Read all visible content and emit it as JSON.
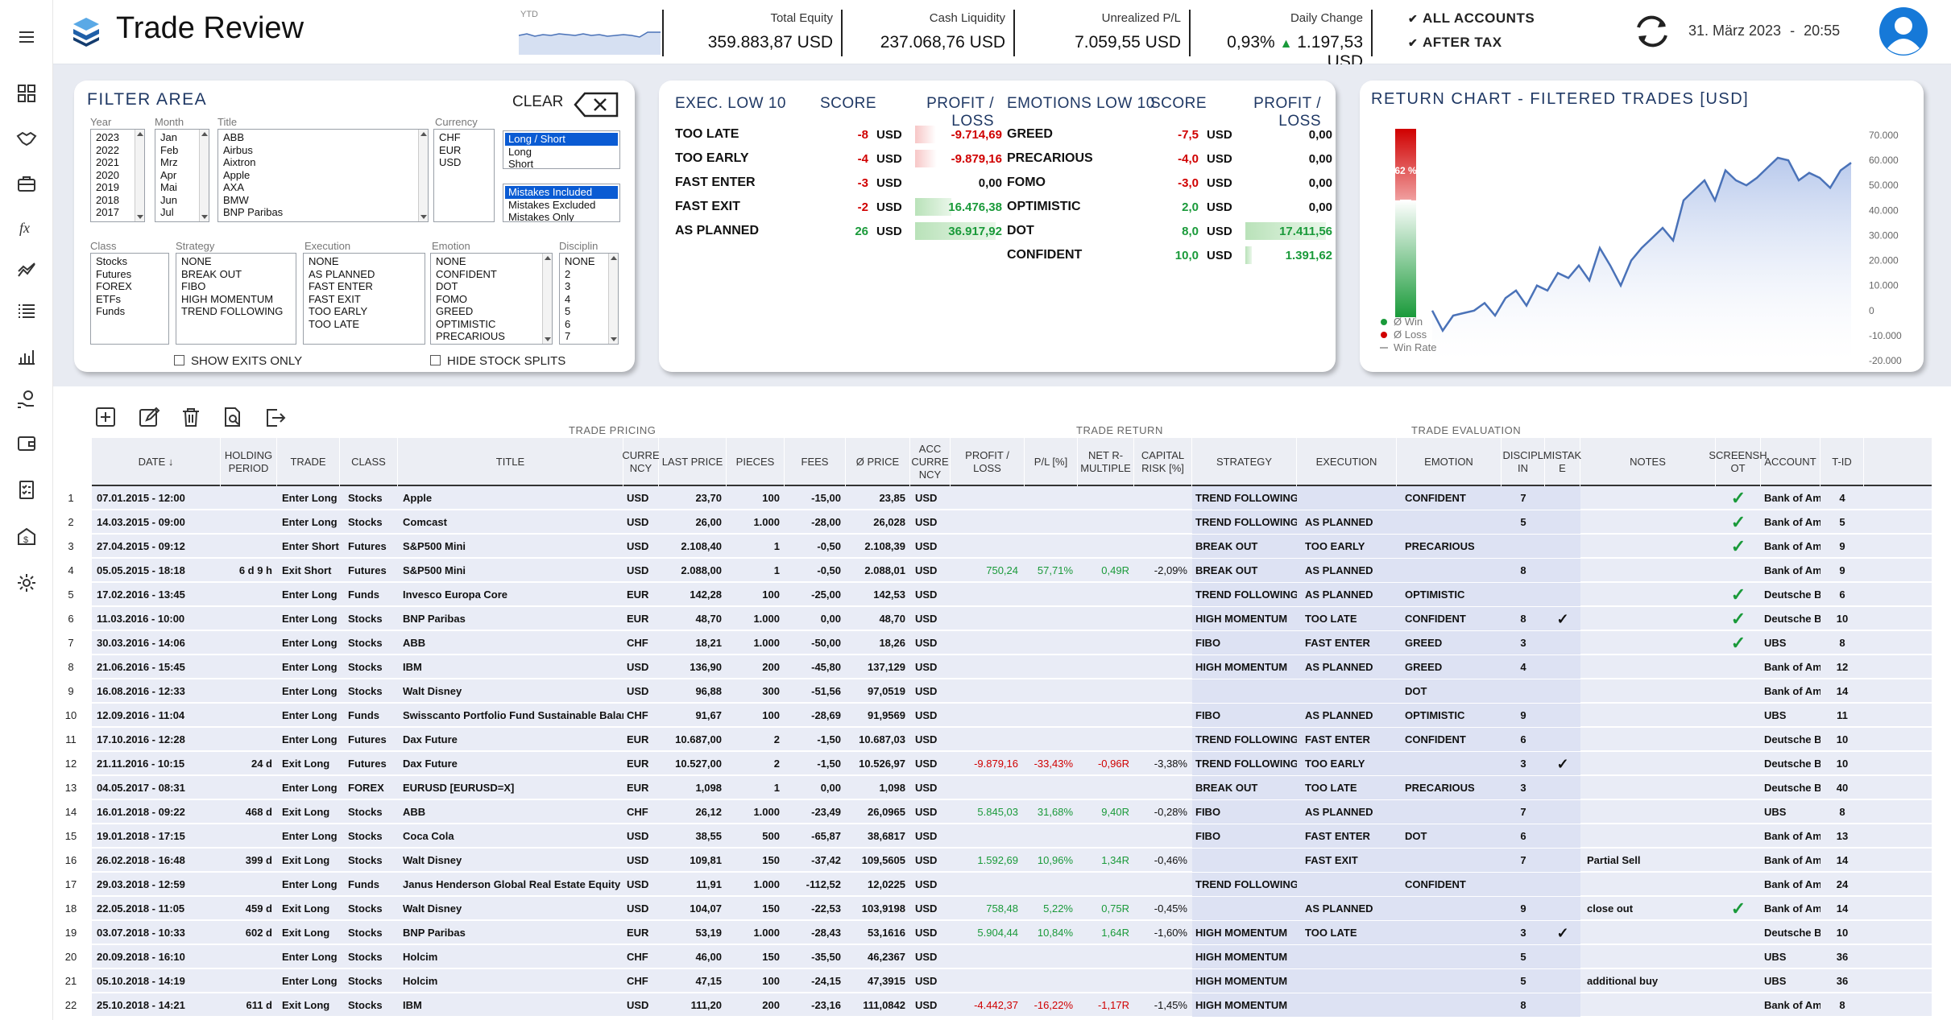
{
  "app": {
    "title": "Trade Review",
    "ytd_label": "YTD",
    "date": "31. März 2023",
    "date_sep": "-",
    "time": "20:55"
  },
  "kpis": [
    {
      "label": "Total Equity",
      "value": "359.883,87 USD"
    },
    {
      "label": "Cash Liquidity",
      "value": "237.068,76 USD"
    },
    {
      "label": "Unrealized P/L",
      "value": "7.059,55 USD"
    },
    {
      "label": "Daily Change",
      "value_pct": "0,93%",
      "value_abs": "1.197,53 USD"
    }
  ],
  "toggles": [
    {
      "label": "ALL ACCOUNTS"
    },
    {
      "label": "AFTER TAX"
    }
  ],
  "filter": {
    "title": "FILTER AREA",
    "clear_label": "CLEAR",
    "year_label": "Year",
    "years": [
      "2023",
      "2022",
      "2021",
      "2020",
      "2019",
      "2018",
      "2017"
    ],
    "month_label": "Month",
    "months": [
      "Jan",
      "Feb",
      "Mrz",
      "Apr",
      "Mai",
      "Jun",
      "Jul"
    ],
    "title_label": "Title",
    "titles": [
      "ABB",
      "Airbus",
      "Aixtron",
      "Apple",
      "AXA",
      "BMW",
      "BNP Paribas"
    ],
    "currency_label": "Currency",
    "currencies": [
      "CHF",
      "EUR",
      "USD"
    ],
    "direction": [
      "Long / Short",
      "Long",
      "Short"
    ],
    "mistakes": [
      "Mistakes Included",
      "Mistakes Excluded",
      "Mistakes Only"
    ],
    "class_label": "Class",
    "classes": [
      "Stocks",
      "Futures",
      "FOREX",
      "ETFs",
      "Funds"
    ],
    "strategy_label": "Strategy",
    "strategies": [
      "NONE",
      "BREAK OUT",
      "FIBO",
      "HIGH MOMENTUM",
      "TREND FOLLOWING"
    ],
    "execution_label": "Execution",
    "executions": [
      "NONE",
      "AS PLANNED",
      "FAST ENTER",
      "FAST EXIT",
      "TOO EARLY",
      "TOO LATE"
    ],
    "emotion_label": "Emotion",
    "emotions": [
      "NONE",
      "CONFIDENT",
      "DOT",
      "FOMO",
      "GREED",
      "OPTIMISTIC",
      "PRECARIOUS"
    ],
    "discipline_label": "Disciplin",
    "disciplines": [
      "NONE",
      "2",
      "3",
      "4",
      "5",
      "6",
      "7"
    ],
    "show_exits_label": "SHOW EXITS ONLY",
    "hide_splits_label": "HIDE STOCK SPLITS"
  },
  "exec_low": {
    "h_name": "EXEC. LOW 10",
    "h_score": "SCORE",
    "h_pl": "PROFIT / LOSS",
    "rows": [
      {
        "name": "TOO LATE",
        "score": "-8",
        "cur": "USD",
        "pl": "-9.714,69",
        "bar": -0.26
      },
      {
        "name": "TOO EARLY",
        "score": "-4",
        "cur": "USD",
        "pl": "-9.879,16",
        "bar": -0.27
      },
      {
        "name": "FAST ENTER",
        "score": "-3",
        "cur": "USD",
        "pl": "0,00",
        "bar": 0
      },
      {
        "name": "FAST EXIT",
        "score": "-2",
        "cur": "USD",
        "pl": "16.476,38",
        "bar": 0.45
      },
      {
        "name": "AS PLANNED",
        "score": "26",
        "cur": "USD",
        "pl": "36.917,92",
        "bar": 1
      }
    ]
  },
  "emo_low": {
    "h_name": "EMOTIONS LOW 10",
    "h_score": "SCORE",
    "h_pl": "PROFIT / LOSS",
    "rows": [
      {
        "name": "GREED",
        "score": "-7,5",
        "cur": "USD",
        "pl": "0,00",
        "bar": 0
      },
      {
        "name": "PRECARIOUS",
        "score": "-4,0",
        "cur": "USD",
        "pl": "0,00",
        "bar": 0
      },
      {
        "name": "FOMO",
        "score": "-3,0",
        "cur": "USD",
        "pl": "0,00",
        "bar": 0
      },
      {
        "name": "OPTIMISTIC",
        "score": "2,0",
        "cur": "USD",
        "pl": "0,00",
        "bar": 0
      },
      {
        "name": "DOT",
        "score": "8,0",
        "cur": "USD",
        "pl": "17.411,56",
        "bar": 1
      },
      {
        "name": "CONFIDENT",
        "score": "10,0",
        "cur": "USD",
        "pl": "1.391,62",
        "bar": 0.08
      }
    ]
  },
  "return_chart": {
    "title": "RETURN CHART - FILTERED TRADES [USD]",
    "win_rate_label": "62 %",
    "win_rate": 0.62,
    "legend": [
      "Ø Win",
      "Ø Loss",
      "Win Rate"
    ],
    "colors": {
      "win": "#1a9a3a",
      "loss": "#d00000",
      "line": "#4a72b8"
    }
  },
  "chart_data": {
    "type": "area",
    "title": "RETURN CHART - FILTERED TRADES [USD]",
    "yticks": [
      "70.000",
      "60.000",
      "50.000",
      "40.000",
      "30.000",
      "20.000",
      "10.000",
      "0",
      "-10.000",
      "-20.000"
    ],
    "ylim": [
      -20000,
      70000
    ],
    "values": [
      0,
      -8000,
      -2000,
      -1000,
      0,
      3000,
      -2000,
      5000,
      8000,
      2000,
      10000,
      8000,
      15000,
      13000,
      18000,
      12000,
      25000,
      18000,
      10000,
      20000,
      25000,
      29000,
      33000,
      28000,
      44000,
      48000,
      52000,
      44000,
      56000,
      52000,
      50000,
      53000,
      57000,
      61000,
      60000,
      52000,
      55000,
      53000,
      49000,
      56000,
      59000
    ]
  },
  "toolbar": [
    "add-icon",
    "edit-icon",
    "delete-icon",
    "search-document-icon",
    "export-icon"
  ],
  "groups": {
    "pricing": "TRADE PRICING",
    "return": "TRADE RETURN",
    "evaluation": "TRADE EVALUATION"
  },
  "columns": [
    "DATE ↓",
    "HOLDING PERIOD",
    "TRADE",
    "CLASS",
    "TITLE",
    "CURRE NCY",
    "LAST PRICE",
    "PIECES",
    "FEES",
    "Ø PRICE",
    "ACC CURRE NCY",
    "PROFIT / LOSS",
    "P/L [%]",
    "NET R-MULTIPLE",
    "CAPITAL RISK [%]",
    "STRATEGY",
    "EXECUTION",
    "EMOTION",
    "DISCIPL IN",
    "MISTAK E",
    "NOTES",
    "SCREENSH OT",
    "ACCOUNT",
    "T-ID"
  ],
  "trades": [
    {
      "n": "1",
      "date": "07.01.2015 - 12:00",
      "hold": "",
      "trade": "Enter Long",
      "class": "Stocks",
      "title": "Apple",
      "cur": "USD",
      "last": "23,70",
      "pcs": "100",
      "fees": "-15,00",
      "avg": "23,85",
      "acc": "USD",
      "pl": "",
      "plp": "",
      "r": "",
      "risk": "",
      "strat": "TREND FOLLOWING",
      "exec": "",
      "emo": "CONFIDENT",
      "disc": "7",
      "mist": "",
      "notes": "",
      "shot": "✓",
      "account": "Bank of America",
      "tid": "4"
    },
    {
      "n": "2",
      "date": "14.03.2015 - 09:00",
      "hold": "",
      "trade": "Enter Long",
      "class": "Stocks",
      "title": "Comcast",
      "cur": "USD",
      "last": "26,00",
      "pcs": "1.000",
      "fees": "-28,00",
      "avg": "26,028",
      "acc": "USD",
      "pl": "",
      "plp": "",
      "r": "",
      "risk": "",
      "strat": "TREND FOLLOWING",
      "exec": "AS PLANNED",
      "emo": "",
      "disc": "5",
      "mist": "",
      "notes": "",
      "shot": "✓",
      "account": "Bank of America",
      "tid": "5"
    },
    {
      "n": "3",
      "date": "27.04.2015 - 09:12",
      "hold": "",
      "trade": "Enter Short",
      "class": "Futures",
      "title": "S&P500 Mini",
      "cur": "USD",
      "last": "2.108,40",
      "pcs": "1",
      "fees": "-0,50",
      "avg": "2.108,39",
      "acc": "USD",
      "pl": "",
      "plp": "",
      "r": "",
      "risk": "",
      "strat": "BREAK OUT",
      "exec": "TOO EARLY",
      "emo": "PRECARIOUS",
      "disc": "",
      "mist": "",
      "notes": "",
      "shot": "✓",
      "account": "Bank of America",
      "tid": "9"
    },
    {
      "n": "4",
      "date": "05.05.2015 - 18:18",
      "hold": "6 d 9 h",
      "trade": "Exit Short",
      "class": "Futures",
      "title": "S&P500 Mini",
      "cur": "USD",
      "last": "2.088,00",
      "pcs": "1",
      "fees": "-0,50",
      "avg": "2.088,01",
      "acc": "USD",
      "pl": "750,24",
      "plp": "57,71%",
      "r": "0,49R",
      "risk": "-2,09%",
      "strat": "BREAK OUT",
      "exec": "AS PLANNED",
      "emo": "",
      "disc": "8",
      "mist": "",
      "notes": "",
      "shot": "",
      "account": "Bank of America",
      "tid": "9"
    },
    {
      "n": "5",
      "date": "17.02.2016 - 13:45",
      "hold": "",
      "trade": "Enter Long",
      "class": "Funds",
      "title": "Invesco Europa Core",
      "cur": "EUR",
      "last": "142,28",
      "pcs": "100",
      "fees": "-25,00",
      "avg": "142,53",
      "acc": "USD",
      "pl": "",
      "plp": "",
      "r": "",
      "risk": "",
      "strat": "TREND FOLLOWING",
      "exec": "AS PLANNED",
      "emo": "OPTIMISTIC",
      "disc": "",
      "mist": "",
      "notes": "",
      "shot": "✓",
      "account": "Deutsche Bank",
      "tid": "6"
    },
    {
      "n": "6",
      "date": "11.03.2016 - 10:00",
      "hold": "",
      "trade": "Enter Long",
      "class": "Stocks",
      "title": "BNP Paribas",
      "cur": "EUR",
      "last": "48,70",
      "pcs": "1.000",
      "fees": "0,00",
      "avg": "48,70",
      "acc": "USD",
      "pl": "",
      "plp": "",
      "r": "",
      "risk": "",
      "strat": "HIGH MOMENTUM",
      "exec": "TOO LATE",
      "emo": "CONFIDENT",
      "disc": "8",
      "mist": "✓",
      "notes": "",
      "shot": "✓",
      "account": "Deutsche Bank",
      "tid": "10"
    },
    {
      "n": "7",
      "date": "30.03.2016 - 14:06",
      "hold": "",
      "trade": "Enter Long",
      "class": "Stocks",
      "title": "ABB",
      "cur": "CHF",
      "last": "18,21",
      "pcs": "1.000",
      "fees": "-50,00",
      "avg": "18,26",
      "acc": "USD",
      "pl": "",
      "plp": "",
      "r": "",
      "risk": "",
      "strat": "FIBO",
      "exec": "FAST ENTER",
      "emo": "GREED",
      "disc": "3",
      "mist": "",
      "notes": "",
      "shot": "✓",
      "account": "UBS",
      "tid": "8"
    },
    {
      "n": "8",
      "date": "21.06.2016 - 15:45",
      "hold": "",
      "trade": "Enter Long",
      "class": "Stocks",
      "title": "IBM",
      "cur": "USD",
      "last": "136,90",
      "pcs": "200",
      "fees": "-45,80",
      "avg": "137,129",
      "acc": "USD",
      "pl": "",
      "plp": "",
      "r": "",
      "risk": "",
      "strat": "HIGH MOMENTUM",
      "exec": "AS PLANNED",
      "emo": "GREED",
      "disc": "4",
      "mist": "",
      "notes": "",
      "shot": "",
      "account": "Bank of America",
      "tid": "12"
    },
    {
      "n": "9",
      "date": "16.08.2016 - 12:33",
      "hold": "",
      "trade": "Enter Long",
      "class": "Stocks",
      "title": "Walt Disney",
      "cur": "USD",
      "last": "96,88",
      "pcs": "300",
      "fees": "-51,56",
      "avg": "97,0519",
      "acc": "USD",
      "pl": "",
      "plp": "",
      "r": "",
      "risk": "",
      "strat": "",
      "exec": "",
      "emo": "DOT",
      "disc": "",
      "mist": "",
      "notes": "",
      "shot": "",
      "account": "Bank of America",
      "tid": "14"
    },
    {
      "n": "10",
      "date": "12.09.2016 - 11:04",
      "hold": "",
      "trade": "Enter Long",
      "class": "Funds",
      "title": "Swisscanto Portfolio Fund Sustainable Balanced [CHF]",
      "cur": "CHF",
      "last": "91,67",
      "pcs": "100",
      "fees": "-28,69",
      "avg": "91,9569",
      "acc": "USD",
      "pl": "",
      "plp": "",
      "r": "",
      "risk": "",
      "strat": "FIBO",
      "exec": "AS PLANNED",
      "emo": "OPTIMISTIC",
      "disc": "9",
      "mist": "",
      "notes": "",
      "shot": "",
      "account": "UBS",
      "tid": "11"
    },
    {
      "n": "11",
      "date": "17.10.2016 - 12:28",
      "hold": "",
      "trade": "Enter Long",
      "class": "Futures",
      "title": "Dax Future",
      "cur": "EUR",
      "last": "10.687,00",
      "pcs": "2",
      "fees": "-1,50",
      "avg": "10.687,03",
      "acc": "USD",
      "pl": "",
      "plp": "",
      "r": "",
      "risk": "",
      "strat": "TREND FOLLOWING",
      "exec": "FAST ENTER",
      "emo": "CONFIDENT",
      "disc": "6",
      "mist": "",
      "notes": "",
      "shot": "",
      "account": "Deutsche Bank",
      "tid": "10"
    },
    {
      "n": "12",
      "date": "21.11.2016 - 10:15",
      "hold": "24 d",
      "trade": "Exit Long",
      "class": "Futures",
      "title": "Dax Future",
      "cur": "EUR",
      "last": "10.527,00",
      "pcs": "2",
      "fees": "-1,50",
      "avg": "10.526,97",
      "acc": "USD",
      "pl": "-9.879,16",
      "plp": "-33,43%",
      "r": "-0,96R",
      "risk": "-3,38%",
      "strat": "TREND FOLLOWING",
      "exec": "TOO EARLY",
      "emo": "",
      "disc": "3",
      "mist": "✓",
      "notes": "",
      "shot": "",
      "account": "Deutsche Bank",
      "tid": "10"
    },
    {
      "n": "13",
      "date": "04.05.2017 - 08:31",
      "hold": "",
      "trade": "Enter Long",
      "class": "FOREX",
      "title": "EURUSD [EURUSD=X]",
      "cur": "EUR",
      "last": "1,098",
      "pcs": "1",
      "fees": "0,00",
      "avg": "1,098",
      "acc": "USD",
      "pl": "",
      "plp": "",
      "r": "",
      "risk": "",
      "strat": "BREAK OUT",
      "exec": "TOO LATE",
      "emo": "PRECARIOUS",
      "disc": "3",
      "mist": "",
      "notes": "",
      "shot": "",
      "account": "Deutsche Bank",
      "tid": "40"
    },
    {
      "n": "14",
      "date": "16.01.2018 - 09:22",
      "hold": "468 d",
      "trade": "Exit Long",
      "class": "Stocks",
      "title": "ABB",
      "cur": "CHF",
      "last": "26,12",
      "pcs": "1.000",
      "fees": "-23,49",
      "avg": "26,0965",
      "acc": "USD",
      "pl": "5.845,03",
      "plp": "31,68%",
      "r": "9,40R",
      "risk": "-0,28%",
      "strat": "FIBO",
      "exec": "AS PLANNED",
      "emo": "",
      "disc": "7",
      "mist": "",
      "notes": "",
      "shot": "",
      "account": "UBS",
      "tid": "8"
    },
    {
      "n": "15",
      "date": "19.01.2018 - 17:15",
      "hold": "",
      "trade": "Enter Long",
      "class": "Stocks",
      "title": "Coca Cola",
      "cur": "USD",
      "last": "38,55",
      "pcs": "500",
      "fees": "-65,87",
      "avg": "38,6817",
      "acc": "USD",
      "pl": "",
      "plp": "",
      "r": "",
      "risk": "",
      "strat": "FIBO",
      "exec": "FAST ENTER",
      "emo": "DOT",
      "disc": "6",
      "mist": "",
      "notes": "",
      "shot": "",
      "account": "Bank of America",
      "tid": "13"
    },
    {
      "n": "16",
      "date": "26.02.2018 - 16:48",
      "hold": "399 d",
      "trade": "Exit Long",
      "class": "Stocks",
      "title": "Walt Disney",
      "cur": "USD",
      "last": "109,81",
      "pcs": "150",
      "fees": "-37,42",
      "avg": "109,5605",
      "acc": "USD",
      "pl": "1.592,69",
      "plp": "10,96%",
      "r": "1,34R",
      "risk": "-0,46%",
      "strat": "",
      "exec": "FAST EXIT",
      "emo": "",
      "disc": "7",
      "mist": "",
      "notes": "Partial Sell",
      "shot": "",
      "account": "Bank of America",
      "tid": "14"
    },
    {
      "n": "17",
      "date": "29.03.2018 - 12:59",
      "hold": "",
      "trade": "Enter Long",
      "class": "Funds",
      "title": "Janus Henderson Global Real Estate Equity Income",
      "cur": "USD",
      "last": "11,91",
      "pcs": "1.000",
      "fees": "-112,52",
      "avg": "12,0225",
      "acc": "USD",
      "pl": "",
      "plp": "",
      "r": "",
      "risk": "",
      "strat": "TREND FOLLOWING",
      "exec": "",
      "emo": "CONFIDENT",
      "disc": "",
      "mist": "",
      "notes": "",
      "shot": "",
      "account": "Bank of America",
      "tid": "24"
    },
    {
      "n": "18",
      "date": "22.05.2018 - 11:05",
      "hold": "459 d",
      "trade": "Exit Long",
      "class": "Stocks",
      "title": "Walt Disney",
      "cur": "USD",
      "last": "104,07",
      "pcs": "150",
      "fees": "-22,53",
      "avg": "103,9198",
      "acc": "USD",
      "pl": "758,48",
      "plp": "5,22%",
      "r": "0,75R",
      "risk": "-0,45%",
      "strat": "",
      "exec": "AS PLANNED",
      "emo": "",
      "disc": "9",
      "mist": "",
      "notes": "close out",
      "shot": "✓",
      "account": "Bank of America",
      "tid": "14"
    },
    {
      "n": "19",
      "date": "03.07.2018 - 10:33",
      "hold": "602 d",
      "trade": "Exit Long",
      "class": "Stocks",
      "title": "BNP Paribas",
      "cur": "EUR",
      "last": "53,19",
      "pcs": "1.000",
      "fees": "-28,43",
      "avg": "53,1616",
      "acc": "USD",
      "pl": "5.904,44",
      "plp": "10,84%",
      "r": "1,64R",
      "risk": "-1,60%",
      "strat": "HIGH MOMENTUM",
      "exec": "TOO LATE",
      "emo": "",
      "disc": "3",
      "mist": "✓",
      "notes": "",
      "shot": "",
      "account": "Deutsche Bank",
      "tid": "10"
    },
    {
      "n": "20",
      "date": "20.09.2018 - 16:10",
      "hold": "",
      "trade": "Enter Long",
      "class": "Stocks",
      "title": "Holcim",
      "cur": "CHF",
      "last": "46,00",
      "pcs": "150",
      "fees": "-35,50",
      "avg": "46,2367",
      "acc": "USD",
      "pl": "",
      "plp": "",
      "r": "",
      "risk": "",
      "strat": "HIGH MOMENTUM",
      "exec": "",
      "emo": "",
      "disc": "5",
      "mist": "",
      "notes": "",
      "shot": "",
      "account": "UBS",
      "tid": "36"
    },
    {
      "n": "21",
      "date": "05.10.2018 - 14:19",
      "hold": "",
      "trade": "Enter Long",
      "class": "Stocks",
      "title": "Holcim",
      "cur": "CHF",
      "last": "47,15",
      "pcs": "100",
      "fees": "-24,15",
      "avg": "47,3915",
      "acc": "USD",
      "pl": "",
      "plp": "",
      "r": "",
      "risk": "",
      "strat": "HIGH MOMENTUM",
      "exec": "",
      "emo": "",
      "disc": "5",
      "mist": "",
      "notes": "additional buy",
      "shot": "",
      "account": "UBS",
      "tid": "36"
    },
    {
      "n": "22",
      "date": "25.10.2018 - 14:21",
      "hold": "611 d",
      "trade": "Exit Long",
      "class": "Stocks",
      "title": "IBM",
      "cur": "USD",
      "last": "111,20",
      "pcs": "200",
      "fees": "-23,16",
      "avg": "111,0842",
      "acc": "USD",
      "pl": "-4.442,37",
      "plp": "-16,22%",
      "r": "-1,17R",
      "risk": "-1,45%",
      "strat": "HIGH MOMENTUM",
      "exec": "",
      "emo": "",
      "disc": "8",
      "mist": "",
      "notes": "",
      "shot": "",
      "account": "Bank of America",
      "tid": "8"
    }
  ]
}
